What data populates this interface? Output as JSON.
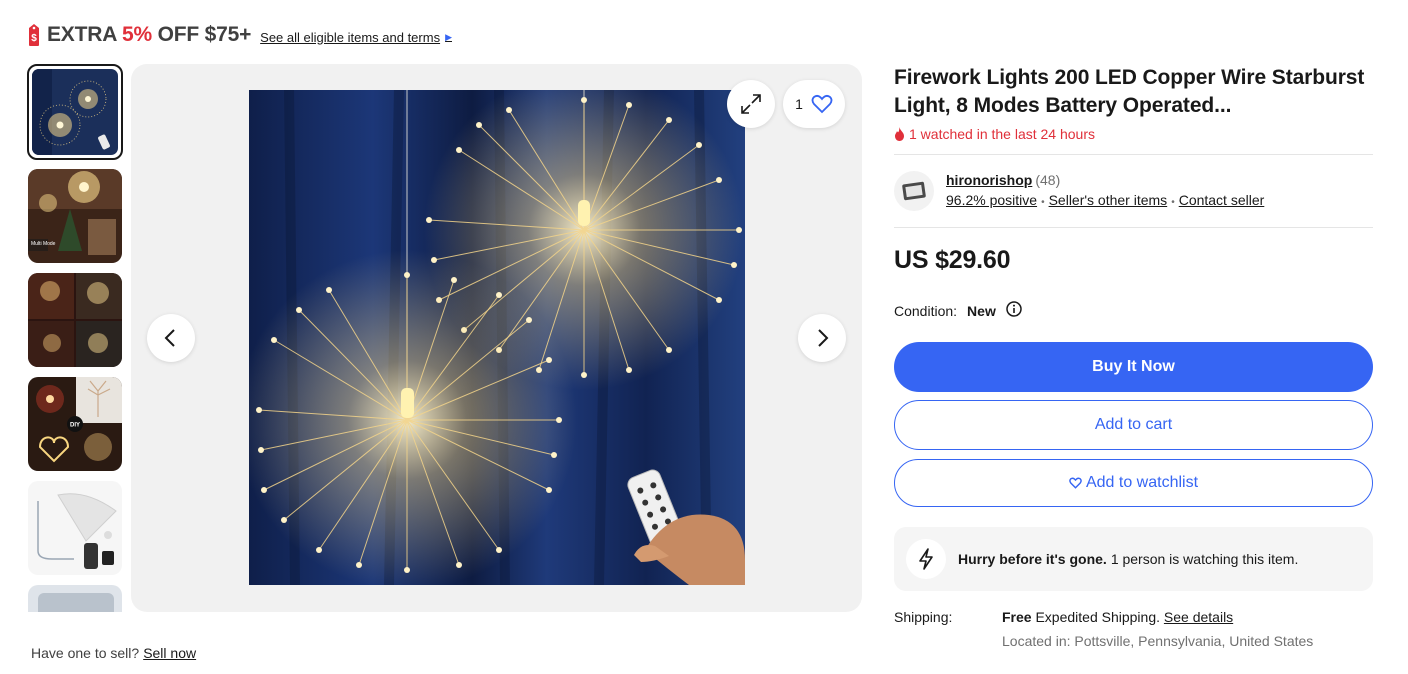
{
  "promo": {
    "extra": "EXTRA ",
    "percent": "5%",
    "rest": " OFF $75+",
    "link": "See all eligible items and terms"
  },
  "gallery": {
    "favorite_count": "1",
    "thumb_labels": [
      "Multi Mode",
      "DIY"
    ]
  },
  "sell": {
    "prompt": "Have one to sell?",
    "link": "Sell now"
  },
  "item": {
    "title": "Firework Lights 200 LED Copper Wire Starburst Light, 8 Modes Battery Operated...",
    "watched": "1 watched in the last 24 hours",
    "price": "US $29.60",
    "condition_label": "Condition:",
    "condition_value": "New"
  },
  "seller": {
    "name": "hironorishop",
    "feedback_count": "(48)",
    "positive": "96.2% positive",
    "other_items": "Seller's other items",
    "contact": "Contact seller"
  },
  "actions": {
    "buy_now": "Buy It Now",
    "add_to_cart": "Add to cart",
    "add_to_watchlist": "Add to watchlist"
  },
  "urgency": {
    "headline": "Hurry before it's gone.",
    "detail": "1 person is watching this item."
  },
  "shipping": {
    "label": "Shipping:",
    "free": "Free",
    "method": " Expedited Shipping.",
    "details_link": "See details",
    "location": "Located in: Pottsville, Pennsylvania, United States"
  },
  "colors": {
    "accent": "#3665f3",
    "alert": "#e0303a",
    "text": "#191919"
  },
  "icons": [
    "price-tag-icon",
    "flame-icon",
    "expand-icon",
    "heart-icon",
    "chevron-left-icon",
    "chevron-right-icon",
    "info-icon",
    "lightning-icon"
  ]
}
